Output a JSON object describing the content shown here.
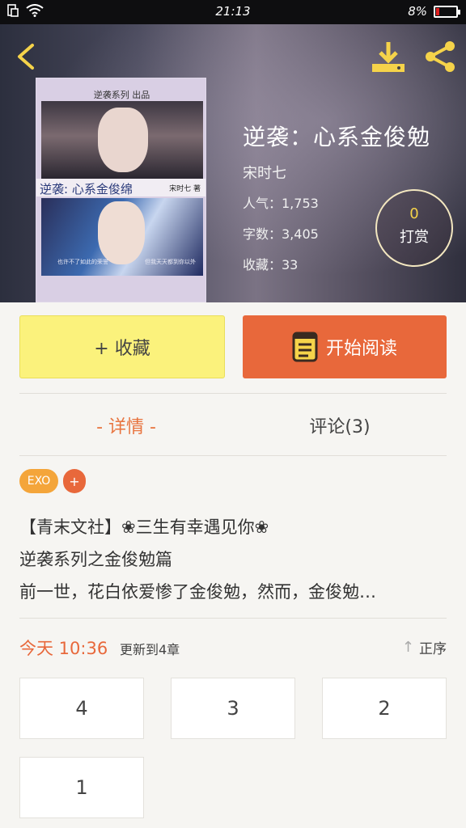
{
  "status_bar": {
    "time": "21:13",
    "battery": "8%",
    "icons": [
      "screenshot-icon",
      "wifi-icon",
      "battery-icon"
    ]
  },
  "header": {
    "back_icon": "chevron-left-icon",
    "download_icon": "download-icon",
    "share_icon": "share-icon",
    "accent_color": "#f5d34a"
  },
  "cover": {
    "publisher": "逆袭系列 出品",
    "title": "逆袭: 心系金俊绵",
    "author": "宋时七 著",
    "tagline_left": "也许不了如此的荣誉",
    "tagline_right": "但我天天都到你以外"
  },
  "book": {
    "title": "逆袭：心系金俊勉",
    "author": "宋时七",
    "popularity": "人气：1,753",
    "word_count": "字数：3,405",
    "favorites": "收藏：33"
  },
  "reward": {
    "count": "0",
    "label": "打赏"
  },
  "actions": {
    "collect_label": "+ 收藏",
    "read_label": "开始阅读",
    "collect_color": "#fbf27c",
    "read_color": "#e8683b"
  },
  "tabs": {
    "details": "- 详情 -",
    "comments": "评论(3)"
  },
  "tags": {
    "items": [
      "EXO"
    ],
    "add_label": "+"
  },
  "description": {
    "lines": [
      "【青末文社】❀三生有幸遇见你❀",
      "逆袭系列之金俊勉篇",
      "前一世，花白依爱惨了金俊勉，然而，金俊勉…"
    ]
  },
  "update": {
    "today": "今天 10:36",
    "chapter_text": "更新到4章",
    "sort_label": "正序"
  },
  "chapters": [
    "4",
    "3",
    "2",
    "1"
  ]
}
